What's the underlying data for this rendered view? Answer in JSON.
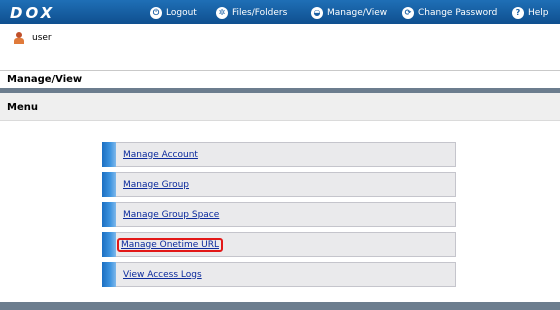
{
  "header": {
    "logo": "DOX",
    "nav": [
      {
        "label": "Logout",
        "icon": "logout-icon",
        "glyph": "⏻"
      },
      {
        "label": "Files/Folders",
        "icon": "folders-icon",
        "glyph": "✲"
      },
      {
        "label": "Manage/View",
        "icon": "manage-icon",
        "glyph": "◒"
      },
      {
        "label": "Change Password",
        "icon": "refresh-icon",
        "glyph": "⟳"
      },
      {
        "label": "Help",
        "icon": "help-icon",
        "glyph": "?"
      }
    ]
  },
  "user": {
    "name": "user"
  },
  "breadcrumb": "Manage/View",
  "menu": {
    "title": "Menu",
    "items": [
      {
        "label": "Manage Account"
      },
      {
        "label": "Manage Group"
      },
      {
        "label": "Manage Group Space"
      },
      {
        "label": "Manage Onetime URL",
        "highlighted": true
      },
      {
        "label": "View Access Logs"
      }
    ]
  },
  "colors": {
    "topbar": "#1a5fa4",
    "separator": "#6c7d8e",
    "highlight": "#e21818",
    "link": "#0b2a9c"
  }
}
